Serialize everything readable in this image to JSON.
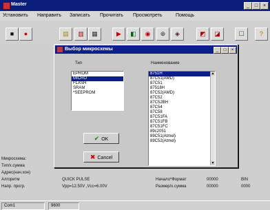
{
  "window": {
    "title": "Master"
  },
  "menu": [
    "Установить",
    "Направить",
    "Записать",
    "Прочитать",
    "Просмотреть",
    "Помощь"
  ],
  "toolbar_icons": [
    "■",
    "●",
    "▤",
    "▥",
    "▦",
    "▶",
    "◧",
    "◉",
    "⊕",
    "◈",
    "◩",
    "◪",
    "☐",
    "?"
  ],
  "status_panels": [
    {
      "label": "Микросхема:",
      "value": ""
    },
    {
      "label": "Тип/х.сумма",
      "value": ""
    },
    {
      "label": "Адрес(нач.хон)",
      "value": ""
    },
    {
      "label": "Алгоритм",
      "value": "QUICK PULSE"
    },
    {
      "label": "Напр. прогр.",
      "value": "Vpp=12.50V   ,Vcc=6.00V"
    }
  ],
  "right_panels": [
    {
      "label": "Начало*Формат",
      "v1": "00000",
      "v2": "BIN"
    },
    {
      "label": "Размер/х.сумма",
      "v1": "00000",
      "v2": "0000"
    }
  ],
  "statusbar": {
    "port": "Com1",
    "speed": "9600"
  },
  "dialog": {
    "title": "Выбор микросхемы",
    "type_label": "Тип",
    "name_label": "Наименование",
    "types": [
      "EPROM",
      "MICRO",
      "FLASH",
      "SRAM",
      "*SEEPROM"
    ],
    "selected_type": "MICRO",
    "names": [
      "8751H",
      "87C51(AMD)",
      "87C51",
      "87518H",
      "87C52(AMD)",
      "87C52",
      "87C52BH",
      "87C54",
      "87C58",
      "87C51FA",
      "87C51FB",
      "87C51FC",
      "89c2051",
      "89C51(Atmel)",
      "89C52(Atmel)"
    ],
    "selected_name": "8751H",
    "ok_label": "OK",
    "cancel_label": "Cancel"
  }
}
